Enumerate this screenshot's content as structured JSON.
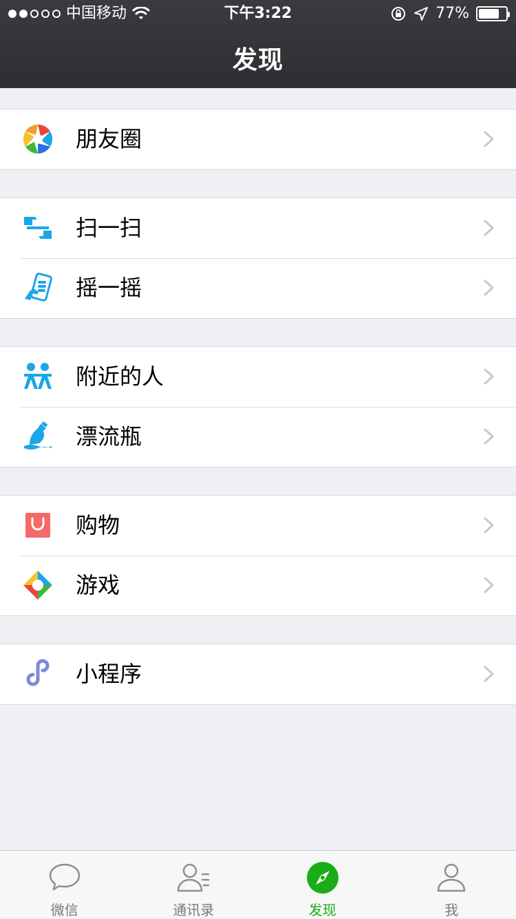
{
  "status_bar": {
    "carrier": "中国移动",
    "time": "下午3:22",
    "battery_percent": "77%",
    "battery_level": 0.77,
    "signal_strength": 2,
    "signal_total": 5
  },
  "nav": {
    "title": "发现"
  },
  "groups": [
    {
      "items": [
        {
          "label": "朋友圈",
          "icon": "moments-aperture-icon"
        }
      ]
    },
    {
      "items": [
        {
          "label": "扫一扫",
          "icon": "scan-icon"
        },
        {
          "label": "摇一摇",
          "icon": "shake-phone-icon"
        }
      ]
    },
    {
      "items": [
        {
          "label": "附近的人",
          "icon": "people-nearby-icon"
        },
        {
          "label": "漂流瓶",
          "icon": "drift-bottle-icon"
        }
      ]
    },
    {
      "items": [
        {
          "label": "购物",
          "icon": "shopping-bag-icon"
        },
        {
          "label": "游戏",
          "icon": "games-icon"
        }
      ]
    },
    {
      "items": [
        {
          "label": "小程序",
          "icon": "mini-program-icon"
        }
      ]
    }
  ],
  "tabbar": {
    "tabs": [
      {
        "label": "微信",
        "icon": "chat-bubble-icon"
      },
      {
        "label": "通讯录",
        "icon": "contacts-icon"
      },
      {
        "label": "发现",
        "icon": "compass-icon",
        "active": true
      },
      {
        "label": "我",
        "icon": "profile-icon"
      }
    ]
  },
  "colors": {
    "nav_bg": "#2f2f33",
    "page_bg": "#efeff4",
    "accent_green": "#1aad19",
    "icon_blue": "#1aa6e8",
    "shopping_red": "#f46a66",
    "mini_program_purple": "#7b8ad9"
  }
}
